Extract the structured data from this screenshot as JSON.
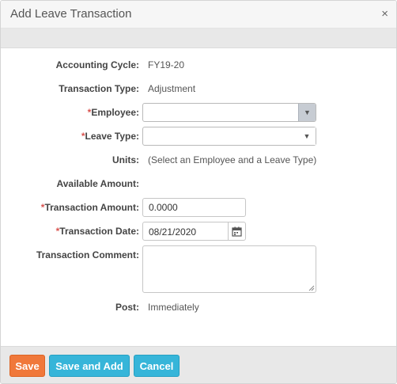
{
  "dialog": {
    "title": "Add Leave Transaction",
    "close_glyph": "×"
  },
  "fields": {
    "accounting_cycle": {
      "label": "Accounting Cycle:",
      "value": "FY19-20"
    },
    "transaction_type": {
      "label": "Transaction Type:",
      "value": "Adjustment"
    },
    "employee": {
      "required_mark": "*",
      "label": "Employee:",
      "value": "",
      "arrow_glyph": "▼"
    },
    "leave_type": {
      "required_mark": "*",
      "label": "Leave Type:",
      "value": "",
      "arrow_glyph": "▼"
    },
    "units": {
      "label": "Units:",
      "value": "(Select an Employee and a Leave Type)"
    },
    "available_amount": {
      "label": "Available Amount:",
      "value": ""
    },
    "transaction_amount": {
      "required_mark": "*",
      "label": "Transaction Amount:",
      "value": "0.0000"
    },
    "transaction_date": {
      "required_mark": "*",
      "label": "Transaction Date:",
      "value": "08/21/2020"
    },
    "transaction_comment": {
      "label": "Transaction Comment:",
      "value": ""
    },
    "post": {
      "label": "Post:",
      "value": "Immediately"
    }
  },
  "footer": {
    "save_label": "Save",
    "save_and_add_label": "Save and Add",
    "cancel_label": "Cancel"
  },
  "colors": {
    "required": "#d9534f",
    "save_button": "#f0783a",
    "secondary_button": "#36b5d9"
  },
  "icons": {
    "close": "close-icon",
    "dropdown": "chevron-down-icon",
    "calendar": "calendar-icon"
  }
}
